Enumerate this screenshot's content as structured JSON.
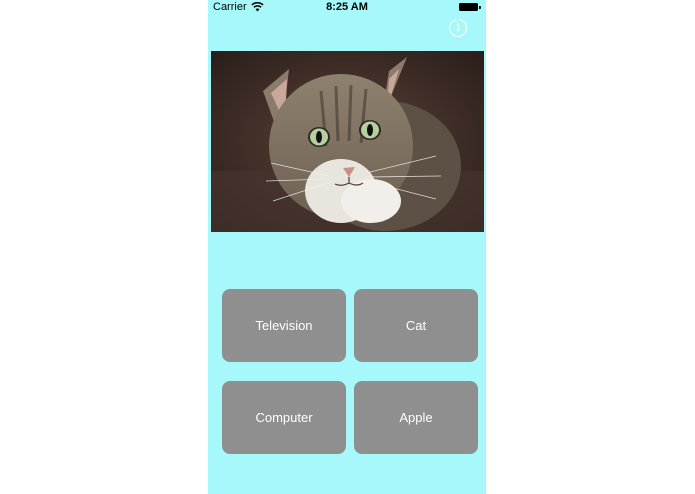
{
  "status_bar": {
    "carrier": "Carrier",
    "time": "8:25 AM"
  },
  "info_button": {
    "glyph": "i",
    "icon": "info-icon",
    "color": "#ffffff"
  },
  "photo": {
    "subject": "cat",
    "icon": "cat-photo"
  },
  "answers": [
    {
      "label": "Television"
    },
    {
      "label": "Cat"
    },
    {
      "label": "Computer"
    },
    {
      "label": "Apple"
    }
  ],
  "colors": {
    "background": "#a6f8fb",
    "button": "#8f8f8f",
    "button_text": "#ffffff"
  }
}
